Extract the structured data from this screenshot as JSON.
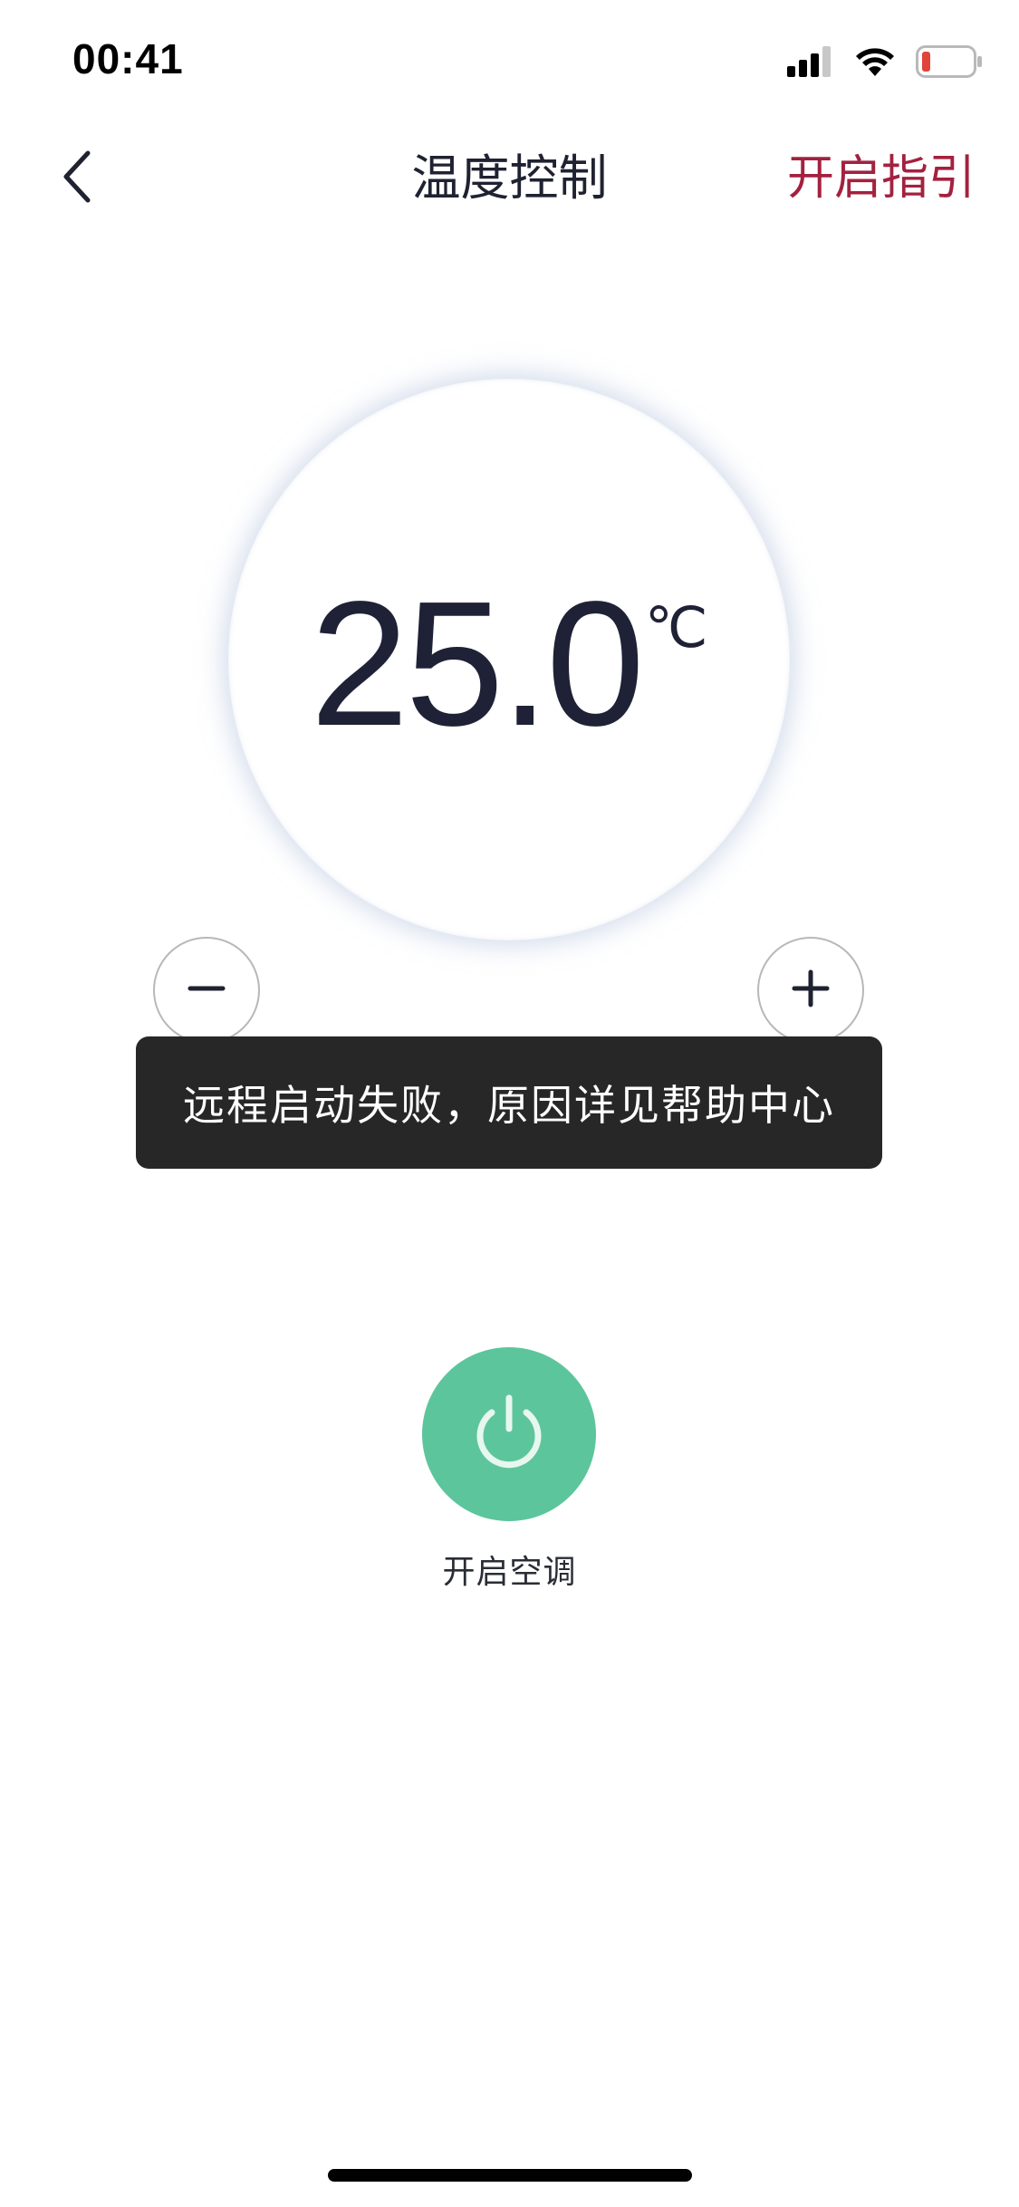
{
  "status_bar": {
    "time": "00:41",
    "icons": [
      "cellular-signal-icon",
      "wifi-icon",
      "battery-low-icon"
    ],
    "battery_color": "#e0443a"
  },
  "nav": {
    "title": "温度控制",
    "guide_label": "开启指引",
    "back_icon": "chevron-left-icon"
  },
  "temperature": {
    "value": "25.0",
    "unit": "℃"
  },
  "stepper": {
    "minus_icon": "minus-icon",
    "plus_icon": "plus-icon"
  },
  "toast": {
    "message": "远程启动失败，原因详见帮助中心"
  },
  "power": {
    "label": "开启空调",
    "icon": "power-icon",
    "color": "#5dc59c"
  },
  "colors": {
    "accent": "#a3213f",
    "text": "#1f2236",
    "toast_bg": "#272727"
  }
}
